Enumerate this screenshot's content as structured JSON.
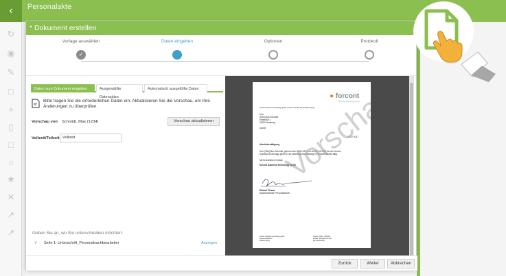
{
  "appbar": {
    "back_icon": "chevron-left-icon",
    "title": "Personalakte"
  },
  "rail_icons": [
    "refresh-icon",
    "eye-icon",
    "edit-icon",
    "document-icon",
    "plus-icon",
    "upload-icon",
    "document-edit-icon",
    "share-icon",
    "star-icon",
    "close-icon",
    "external-icon",
    "external-icon-2"
  ],
  "dialog": {
    "title": "* Dokument erstellen",
    "steps": [
      {
        "label": "Vorlage auswählen",
        "state": "done"
      },
      {
        "label": "Daten eingeben",
        "state": "active"
      },
      {
        "label": "Optionen",
        "state": "todo"
      },
      {
        "label": "Protokoll",
        "state": "todo"
      }
    ],
    "tabs": [
      {
        "label": "Daten zum Dokument eingeben",
        "active": true
      },
      {
        "label": "Ausgewählte Datensätze",
        "active": false
      },
      {
        "label": "Automatisch ausgefüllte Daten",
        "active": false
      }
    ],
    "info_text": "Bitte tragen Sie die erforderlichen Daten ein. Aktualisieren Sie die Vorschau, um Ihre Änderungen zu überprüfen.",
    "preview_for_label": "Vorschau von",
    "preview_for_value": "Schmidt, Max (1234)",
    "refresh_button": "Vorschau aktualisieren",
    "field_label": "Vollzeit/Teilzeit",
    "field_value": "Vollzeit",
    "signature_question": "Geben Sie an, wo Sie unterschreiben möchten:",
    "signature_item": "Seite 1: Unterschrift_Personalsachbearbeiter",
    "signature_link": "Anzeigen",
    "footer": {
      "back": "Zurück",
      "next": "Weiter",
      "cancel": "Abbrechen"
    }
  },
  "document": {
    "logo": "forcont",
    "logo_sub": "business technology gmbh",
    "sender_line": "forcont business technology gmbh | Nonnenstraße 39 | 04229 Leipzig",
    "address": [
      "Herr",
      "[Titel] Max Schmidt",
      "Elbstraße 1",
      "20000 Hamburg",
      "",
      "[Land]"
    ],
    "date": "14.07.2017",
    "subject": "Arbeitsbestätigung",
    "body": [
      "Herr [Titel] Max Schmidt, geboren am 04.06.1974, ist seit 01.02.2000 bei der forcont",
      "business technology gmbh in der Abteilung Buchhaltung in [Vollzeit/Teilzeit] tätig."
    ],
    "closing": "Mit freundlichen Grüßen",
    "company": "forcont business technology gmbh",
    "signer_name": "Eduard Pinson",
    "signer_role": "Sachbearbeiter Personalwesen",
    "watermark": "Vorschau",
    "footer_left": [
      "forcont business technology gmbh",
      "Nonnenstraße 39",
      "04229 Leipzig"
    ],
    "footer_right": [
      "Telefon: 0341 - 48503-0",
      "E-Mail: office@forcont.de",
      "[Firma Website]"
    ]
  },
  "accent": "#8bbf4f",
  "link_color": "#3da0c8"
}
